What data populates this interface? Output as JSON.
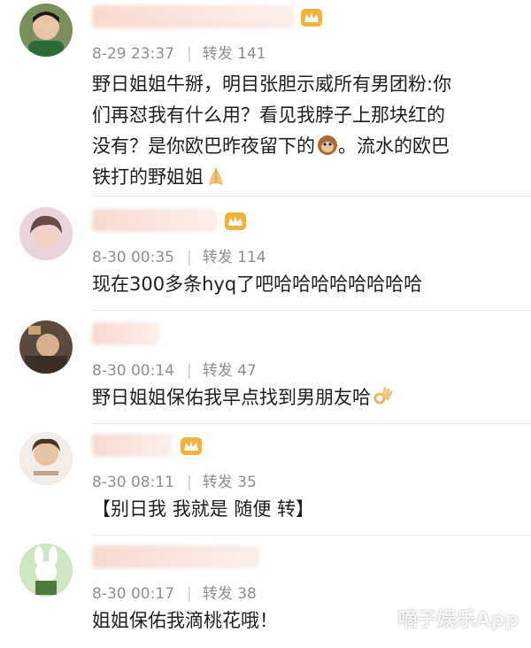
{
  "comments": [
    {
      "date": "8-29 23:37",
      "repost_label": "转发",
      "repost_count": "141",
      "text_lines": [
        "野日姐姐牛掰，明目张胆示威所有男团粉:你",
        "们再怼我有什么用？看见我脖子上那块红的",
        "没有？是你欧巴昨夜留下的",
        "。流水的欧巴",
        "铁打的野姐姐"
      ],
      "emoji_1": "monkey-face",
      "emoji_2": "folded-hands"
    },
    {
      "date": "8-30 00:35",
      "repost_label": "转发",
      "repost_count": "114",
      "text": "现在300多条hyq了吧哈哈哈哈哈哈哈哈"
    },
    {
      "date": "8-30 00:14",
      "repost_label": "转发",
      "repost_count": "47",
      "text": "野日姐姐保佑我早点找到男朋友哈",
      "emoji": "ok-hand"
    },
    {
      "date": "8-30 08:11",
      "repost_label": "转发",
      "repost_count": "35",
      "text": "【别日我 我就是 随便 转】"
    },
    {
      "date": "8-30 00:17",
      "repost_label": "转发",
      "repost_count": "38",
      "text": "姐姐保佑我滴桃花哦！"
    }
  ],
  "watermark": "嘀子娱乐App",
  "colors": {
    "meta_gray": "#8f8f8f",
    "crown_gold": "#f3b13a",
    "name_blur": "#f6d9cf",
    "divider": "#ebebeb"
  }
}
